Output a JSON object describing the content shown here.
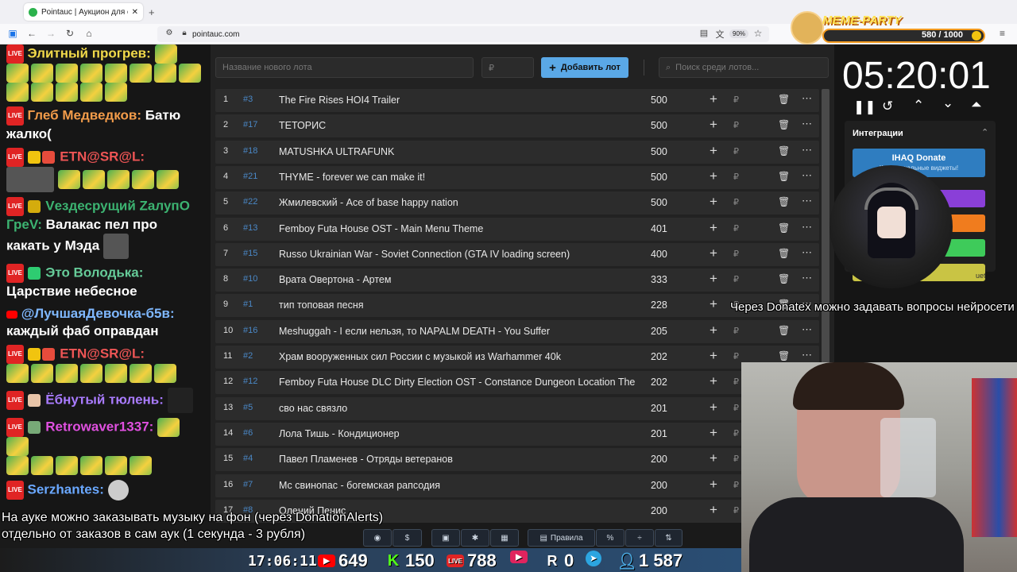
{
  "browser": {
    "tab_title": "Pointauc | Аукцион для стрим",
    "url": "pointauc.com",
    "zoom": "90%"
  },
  "chat": {
    "messages": [
      {
        "user": "Элитный прогрев:",
        "text": ""
      },
      {
        "user": "Глеб Медведков:",
        "text": "Батю жалко("
      },
      {
        "user": "EТN@SR@L:",
        "text": ""
      },
      {
        "user": "Vездесрущий ZалупО ГреV:",
        "text": "Валакас пел про какать у Мэда"
      },
      {
        "user": "Это Володька:",
        "text": "Царствие небесное"
      },
      {
        "user": "@ЛучшаяДевочка-б5в:",
        "text": "каждый фаб оправдан"
      },
      {
        "user": "EТN@SR@L:",
        "text": ""
      },
      {
        "user": "Ёбнутый тюлень:",
        "text": ""
      },
      {
        "user": "Retrowaver1337:",
        "text": ""
      },
      {
        "user": "Serzhantes:",
        "text": ""
      }
    ],
    "badge": "LIVE"
  },
  "auction": {
    "lot_placeholder": "Название нового лота",
    "amount_placeholder": "₽",
    "add_button": "Добавить лот",
    "search_placeholder": "Поиск среди лотов...",
    "rows": [
      {
        "n": "1",
        "id": "#3",
        "name": "The Fire Rises HOI4 Trailer",
        "amount": "500"
      },
      {
        "n": "2",
        "id": "#17",
        "name": "ТЕТОРИС",
        "amount": "500"
      },
      {
        "n": "3",
        "id": "#18",
        "name": "MATUSHKA ULTRAFUNK",
        "amount": "500"
      },
      {
        "n": "4",
        "id": "#21",
        "name": "THYME - forever we can make it!",
        "amount": "500"
      },
      {
        "n": "5",
        "id": "#22",
        "name": "Жмилевский - Ace of base happy nation",
        "amount": "500"
      },
      {
        "n": "6",
        "id": "#13",
        "name": "Femboy Futa House OST - Main Menu Theme",
        "amount": "401"
      },
      {
        "n": "7",
        "id": "#15",
        "name": "Russo Ukrainian War - Soviet Connection (GTA IV loading screen)",
        "amount": "400"
      },
      {
        "n": "8",
        "id": "#10",
        "name": "Врата Овертона - Артем",
        "amount": "333"
      },
      {
        "n": "9",
        "id": "#1",
        "name": "тип топовая песня",
        "amount": "228"
      },
      {
        "n": "10",
        "id": "#16",
        "name": "Meshuggah - I если нельзя, то NAPALM DEATH - You Suffer",
        "amount": "205"
      },
      {
        "n": "11",
        "id": "#2",
        "name": "Храм вооруженных сил России с музыкой из Warhammer 40k",
        "amount": "202"
      },
      {
        "n": "12",
        "id": "#12",
        "name": "Femboy Futa House DLC Dirty Election OST - Constance Dungeon Location The",
        "amount": "202"
      },
      {
        "n": "13",
        "id": "#5",
        "name": "сво нас связло",
        "amount": "201"
      },
      {
        "n": "14",
        "id": "#6",
        "name": "Лола Тишь - Кондиционер",
        "amount": "201"
      },
      {
        "n": "15",
        "id": "#4",
        "name": "Павел Пламенев - Отряды ветеранов",
        "amount": "200"
      },
      {
        "n": "16",
        "id": "#7",
        "name": "Мс свинопас - богемская рапсодия",
        "amount": "200"
      },
      {
        "n": "17",
        "id": "#8",
        "name": "Олений Пенис",
        "amount": "200"
      }
    ],
    "currency": "₽"
  },
  "right_panel": {
    "timer": "05:20:01",
    "integrations_label": "Интеграции",
    "ihaq_label": "IHAQ Donate",
    "ihaq_sub": "Ко... уникальные виджеты!",
    "extra_label": "uet"
  },
  "meme_party": {
    "label": "MEME-PARTY",
    "progress": "580 / 1000"
  },
  "overlays": {
    "donatex_note": "Через Donatex можно задавать вопросы нейросети",
    "music_line1": "На ауке можно заказывать музыку на фон (через DonationAlerts)",
    "music_line2": "отдельно от заказов в сам аук (1 секунда - 3 рубля)"
  },
  "toolbar": {
    "rules_label": "Правила"
  },
  "stats": {
    "clock": "17:06:11",
    "youtube": "649",
    "kick": "150",
    "vk": "788",
    "rutube": "0",
    "telegram": "",
    "viewers": "1 587"
  },
  "colors": {
    "accent": "#5aa8e6",
    "live_red": "#e02424",
    "row_bg": "#2c2c2c",
    "lot_id": "#4a88c7"
  }
}
